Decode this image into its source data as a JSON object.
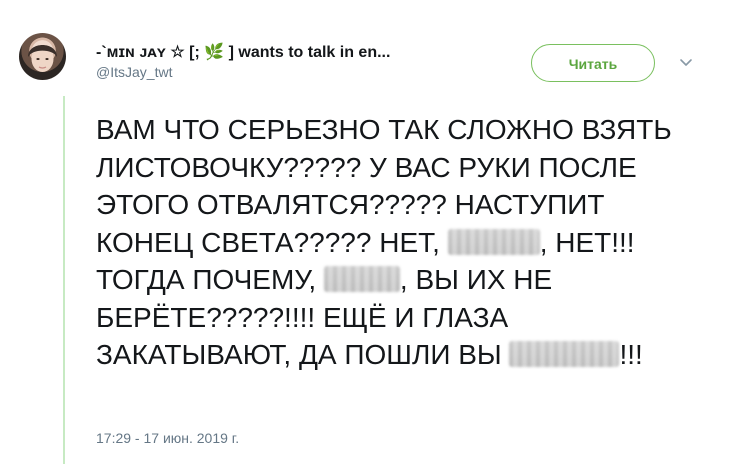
{
  "tweet": {
    "display_name": "-`ᴍɪɴ ᴊᴀʏ ☆ [; 🌿 ] wants to talk in en...",
    "handle": "@ItsJay_twt",
    "follow_label": "Читать",
    "text_parts": {
      "p1": "ВАМ ЧТО СЕРЬЕЗНО ТАК СЛОЖНО ВЗЯТЬ ЛИСТОВОЧКУ????? У ВАС РУКИ ПОСЛЕ ЭТОГО ОТВАЛЯТСЯ????? НАСТУПИТ КОНЕЦ СВЕТА????? НЕТ, ",
      "p2": ", НЕТ!!! ТОГДА ПОЧЕМУ, ",
      "p3": ", ВЫ ИХ НЕ БЕРЁТЕ?????!!!! ЕЩЁ И ГЛАЗА ЗАКАТЫВАЮТ, ДА ПОШЛИ ВЫ ",
      "p4": "!!!"
    },
    "timestamp": "17:29 - 17 июн. 2019 г."
  },
  "colors": {
    "accent": "#5ba63f",
    "thread_line": "#c7eac3",
    "secondary_text": "#657786"
  },
  "icons": {
    "caret": "chevron-down-icon",
    "star": "star-icon",
    "leaf": "leaf-icon"
  }
}
